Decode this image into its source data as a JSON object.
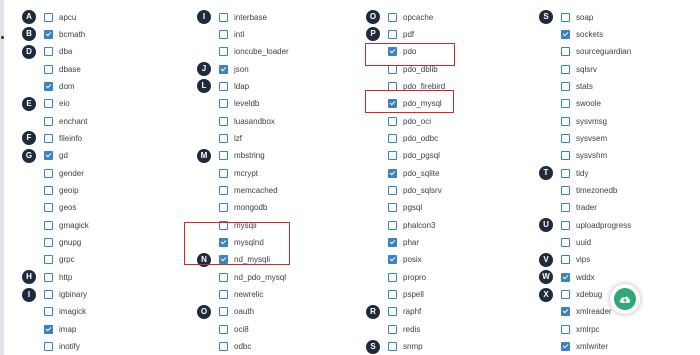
{
  "columns": [
    {
      "groups": [
        {
          "letter": "A",
          "items": [
            {
              "label": "apcu",
              "checked": false
            }
          ]
        },
        {
          "letter": "B",
          "items": [
            {
              "label": "bcmath",
              "checked": true
            }
          ]
        },
        {
          "letter": "D",
          "items": [
            {
              "label": "dba",
              "checked": false
            },
            {
              "label": "dbase",
              "checked": false
            },
            {
              "label": "dom",
              "checked": true
            }
          ]
        },
        {
          "letter": "E",
          "items": [
            {
              "label": "eio",
              "checked": false
            },
            {
              "label": "enchant",
              "checked": false
            }
          ]
        },
        {
          "letter": "F",
          "items": [
            {
              "label": "fileinfo",
              "checked": false
            }
          ]
        },
        {
          "letter": "G",
          "items": [
            {
              "label": "gd",
              "checked": true
            },
            {
              "label": "gender",
              "checked": false
            },
            {
              "label": "geoip",
              "checked": false
            },
            {
              "label": "geos",
              "checked": false
            },
            {
              "label": "gmagick",
              "checked": false
            },
            {
              "label": "gnupg",
              "checked": false
            },
            {
              "label": "grpc",
              "checked": false
            }
          ]
        },
        {
          "letter": "H",
          "items": [
            {
              "label": "http",
              "checked": false
            }
          ]
        },
        {
          "letter": "I",
          "items": [
            {
              "label": "igbinary",
              "checked": false
            },
            {
              "label": "imagick",
              "checked": false
            },
            {
              "label": "imap",
              "checked": true
            },
            {
              "label": "inotify",
              "checked": false
            }
          ]
        }
      ]
    },
    {
      "groups": [
        {
          "letter": "I",
          "items": [
            {
              "label": "interbase",
              "checked": false
            },
            {
              "label": "intl",
              "checked": false
            },
            {
              "label": "ioncube_loader",
              "checked": false
            }
          ]
        },
        {
          "letter": "J",
          "items": [
            {
              "label": "json",
              "checked": true
            }
          ]
        },
        {
          "letter": "L",
          "items": [
            {
              "label": "ldap",
              "checked": false
            },
            {
              "label": "leveldb",
              "checked": false
            },
            {
              "label": "luasandbox",
              "checked": false
            },
            {
              "label": "lzf",
              "checked": false
            }
          ]
        },
        {
          "letter": "M",
          "items": [
            {
              "label": "mbstring",
              "checked": false
            },
            {
              "label": "mcrypt",
              "checked": false
            },
            {
              "label": "memcached",
              "checked": false
            },
            {
              "label": "mongodb",
              "checked": false
            },
            {
              "label": "mysqli",
              "checked": false
            },
            {
              "label": "mysqlnd",
              "checked": true
            }
          ]
        },
        {
          "letter": "N",
          "items": [
            {
              "label": "nd_mysqli",
              "checked": true
            },
            {
              "label": "nd_pdo_mysql",
              "checked": false
            },
            {
              "label": "newrelic",
              "checked": false
            }
          ]
        },
        {
          "letter": "O",
          "items": [
            {
              "label": "oauth",
              "checked": false
            },
            {
              "label": "oci8",
              "checked": false
            },
            {
              "label": "odbc",
              "checked": false
            }
          ]
        }
      ]
    },
    {
      "groups": [
        {
          "letter": "O",
          "items": [
            {
              "label": "opcache",
              "checked": false
            }
          ]
        },
        {
          "letter": "P",
          "items": [
            {
              "label": "pdf",
              "checked": false
            },
            {
              "label": "pdo",
              "checked": true
            },
            {
              "label": "pdo_dblib",
              "checked": false
            },
            {
              "label": "pdo_firebird",
              "checked": false
            },
            {
              "label": "pdo_mysql",
              "checked": true
            },
            {
              "label": "pdo_oci",
              "checked": false
            },
            {
              "label": "pdo_odbc",
              "checked": false
            },
            {
              "label": "pdo_pgsql",
              "checked": false
            },
            {
              "label": "pdo_sqlite",
              "checked": true
            },
            {
              "label": "pdo_sqlsrv",
              "checked": false
            },
            {
              "label": "pgsql",
              "checked": false
            },
            {
              "label": "phalcon3",
              "checked": false
            },
            {
              "label": "phar",
              "checked": true
            },
            {
              "label": "posix",
              "checked": true
            },
            {
              "label": "propro",
              "checked": false
            },
            {
              "label": "pspell",
              "checked": false
            }
          ]
        },
        {
          "letter": "R",
          "items": [
            {
              "label": "raphf",
              "checked": false
            },
            {
              "label": "redis",
              "checked": false
            }
          ]
        },
        {
          "letter": "S",
          "items": [
            {
              "label": "snmp",
              "checked": false
            }
          ]
        }
      ]
    },
    {
      "groups": [
        {
          "letter": "S",
          "items": [
            {
              "label": "soap",
              "checked": false
            },
            {
              "label": "sockets",
              "checked": true
            },
            {
              "label": "sourceguardian",
              "checked": false
            },
            {
              "label": "sqlsrv",
              "checked": false
            },
            {
              "label": "stats",
              "checked": false
            },
            {
              "label": "swoole",
              "checked": false
            },
            {
              "label": "sysvmsg",
              "checked": false
            },
            {
              "label": "sysvsem",
              "checked": false
            },
            {
              "label": "sysvshm",
              "checked": false
            }
          ]
        },
        {
          "letter": "T",
          "items": [
            {
              "label": "tidy",
              "checked": false
            },
            {
              "label": "timezonedb",
              "checked": false
            },
            {
              "label": "trader",
              "checked": false
            }
          ]
        },
        {
          "letter": "U",
          "items": [
            {
              "label": "uploadprogress",
              "checked": false
            },
            {
              "label": "uuid",
              "checked": false
            }
          ]
        },
        {
          "letter": "V",
          "items": [
            {
              "label": "vips",
              "checked": false
            }
          ]
        },
        {
          "letter": "W",
          "items": [
            {
              "label": "wddx",
              "checked": true
            }
          ]
        },
        {
          "letter": "X",
          "items": [
            {
              "label": "xdebug",
              "checked": false
            },
            {
              "label": "xmlreader",
              "checked": true
            },
            {
              "label": "xmlrpc",
              "checked": false
            },
            {
              "label": "xmlwriter",
              "checked": true
            }
          ]
        }
      ]
    }
  ],
  "highlighted": [
    "pdo",
    "pdo_mysql",
    "mysqlnd",
    "nd_mysqli"
  ],
  "floating_button": {
    "icon": "cloud-upload-icon",
    "color": "#2fa875"
  },
  "colors": {
    "checkbox": "#3b82c4",
    "letter_badge": "#1f2b3d",
    "highlight": "#d9252a"
  }
}
